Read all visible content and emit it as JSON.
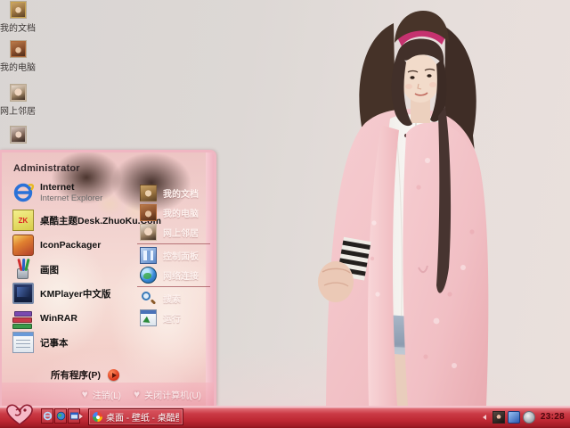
{
  "desktop": {
    "icons": [
      {
        "label": "我的文档"
      },
      {
        "label": "我的电脑"
      },
      {
        "label": "网上邻居"
      },
      {
        "label": ""
      }
    ]
  },
  "start_menu": {
    "user": "Administrator",
    "left_items": [
      {
        "label": "Internet",
        "sub": "Internet Explorer",
        "icon": "internet-explorer-icon"
      },
      {
        "label": "桌酷主题Desk.ZhuoKu.Com",
        "icon": "zhuoku-icon"
      },
      {
        "label": "IconPackager",
        "icon": "iconpackager-icon"
      },
      {
        "label": "画图",
        "icon": "paint-icon"
      },
      {
        "label": "KMPlayer中文版",
        "icon": "kmplayer-icon"
      },
      {
        "label": "WinRAR",
        "icon": "winrar-icon"
      },
      {
        "label": "记事本",
        "icon": "notepad-icon"
      }
    ],
    "all_programs": "所有程序(P)",
    "right_items": [
      {
        "label": "我的文档",
        "icon": "photo-icon"
      },
      {
        "label": "我的电脑",
        "icon": "photo-icon"
      },
      {
        "label": "网上邻居",
        "icon": "photo-icon"
      },
      {
        "label": "控制面板",
        "icon": "control-panel-icon"
      },
      {
        "label": "网络连接",
        "icon": "globe-icon"
      },
      {
        "label": "搜索",
        "icon": "search-icon"
      },
      {
        "label": "运行",
        "icon": "run-icon"
      }
    ],
    "log_off": "注销(L)",
    "turn_off": "关闭计算机(U)"
  },
  "taskbar": {
    "task_button_label": "桌面 - 壁纸 - 桌酷壁…",
    "clock": "23:28"
  },
  "icons": {
    "zhuoku_text": "ZK",
    "heart": "♥"
  },
  "colors": {
    "taskbar_red": "#bc2732",
    "menu_border_pink": "#f0b6c2",
    "headband_pink": "#c5326f",
    "cardigan_pink": "#f2c3c8"
  }
}
